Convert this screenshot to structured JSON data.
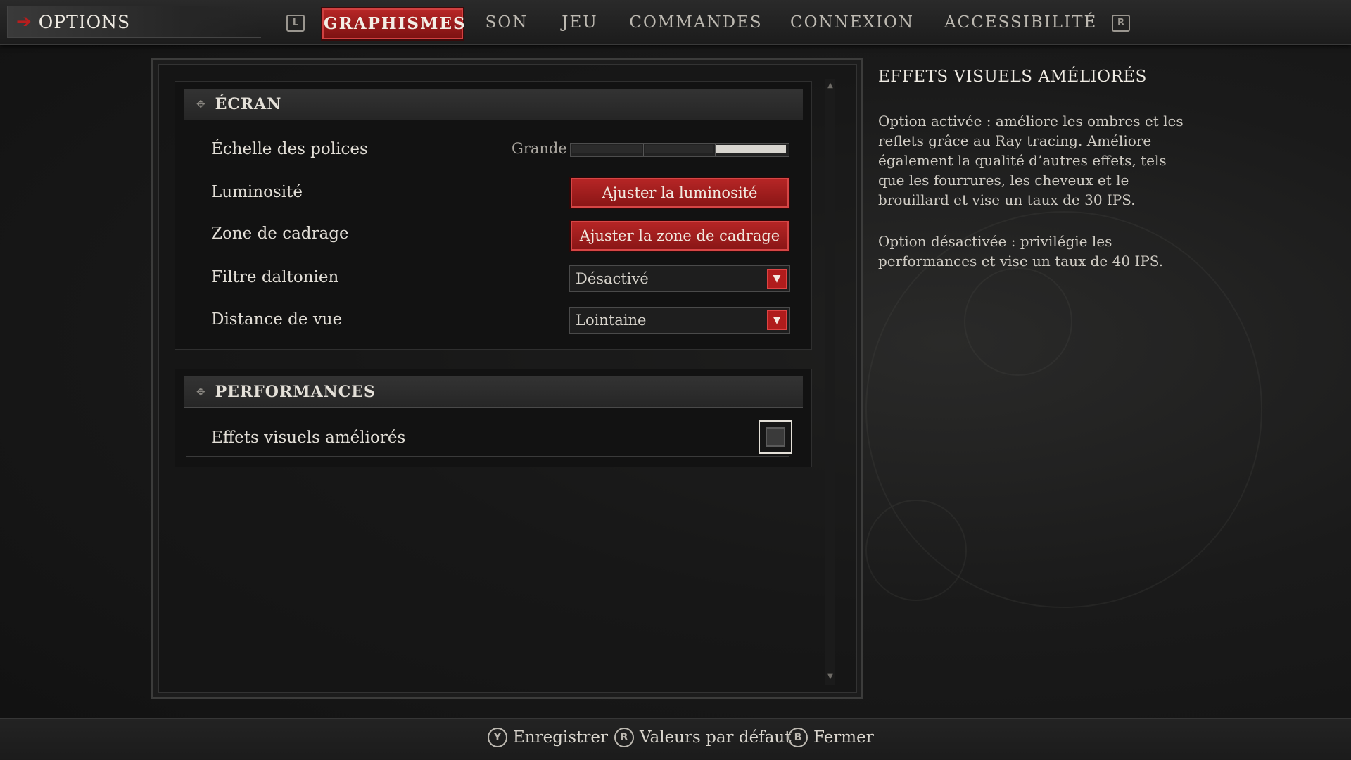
{
  "topbar": {
    "title": "OPTIONS",
    "left_bumper": "L",
    "right_bumper": "R",
    "tabs": [
      {
        "label": "GRAPHISMES",
        "active": true
      },
      {
        "label": "SON",
        "active": false
      },
      {
        "label": "JEU",
        "active": false
      },
      {
        "label": "COMMANDES",
        "active": false
      },
      {
        "label": "CONNEXION",
        "active": false
      },
      {
        "label": "ACCESSIBILITÉ",
        "active": false
      }
    ]
  },
  "sections": {
    "screen": {
      "title": "ÉCRAN",
      "font_scale": {
        "label": "Échelle des polices",
        "value": "Grande",
        "level": 3,
        "levels": 3
      },
      "brightness": {
        "label": "Luminosité",
        "button": "Ajuster la luminosité"
      },
      "framing": {
        "label": "Zone de cadrage",
        "button": "Ajuster la zone de cadrage"
      },
      "colorblind": {
        "label": "Filtre daltonien",
        "value": "Désactivé"
      },
      "view_distance": {
        "label": "Distance de vue",
        "value": "Lointaine"
      }
    },
    "performance": {
      "title": "PERFORMANCES",
      "enhanced_visuals": {
        "label": "Effets visuels améliorés",
        "checked": false
      }
    }
  },
  "description": {
    "title": "EFFETS VISUELS AMÉLIORÉS",
    "on_text": "Option activée : améliore les ombres et les reflets grâce au Ray tracing. Améliore également la qualité d’autres effets, tels que les fourrures, les cheveux et le brouillard et vise un taux de 30 IPS.",
    "off_text": "Option désactivée : privilégie les performances et vise un taux de 40 IPS."
  },
  "footer": {
    "save": {
      "glyph": "Y",
      "label": "Enregistrer"
    },
    "defaults": {
      "glyph": "R",
      "label": "Valeurs par défaut"
    },
    "close": {
      "glyph": "B",
      "label": "Fermer"
    }
  },
  "colors": {
    "accent": "#b62626",
    "background": "#151515",
    "text": "#d9d6cf"
  }
}
